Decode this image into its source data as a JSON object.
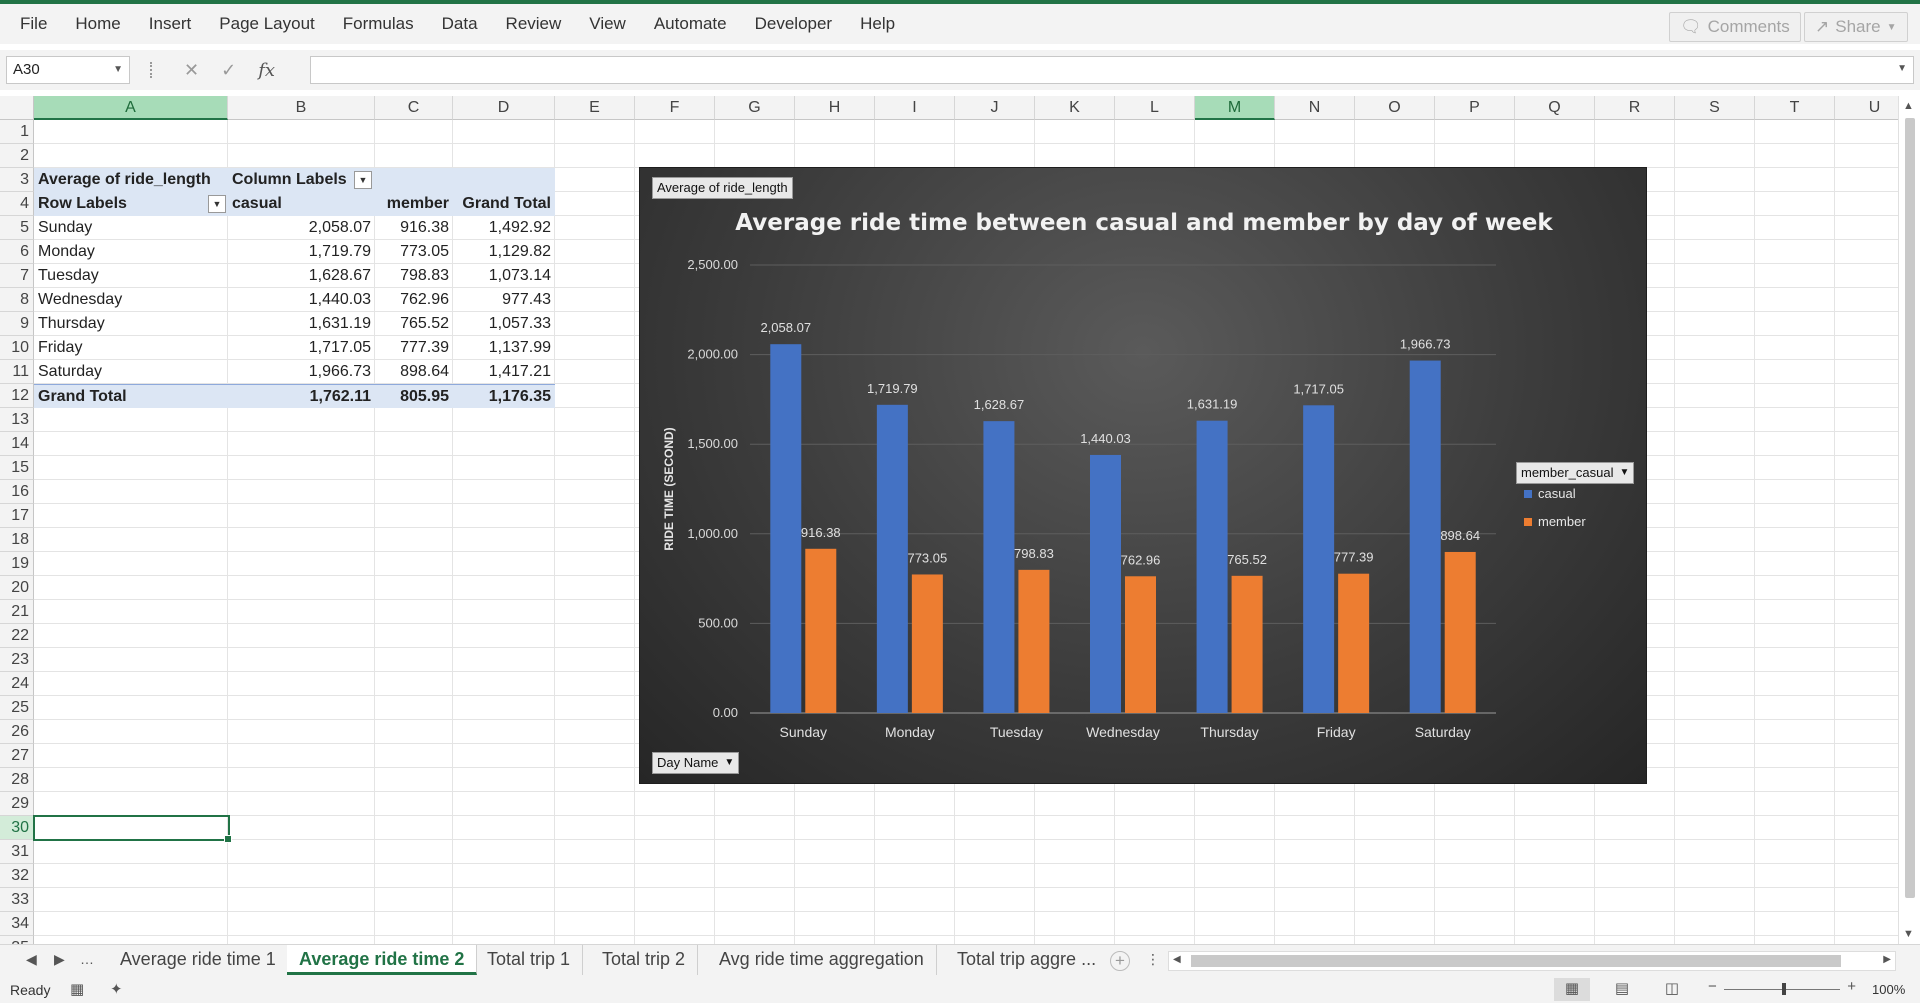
{
  "ribbon": {
    "menu": [
      "File",
      "Home",
      "Insert",
      "Page Layout",
      "Formulas",
      "Data",
      "Review",
      "View",
      "Automate",
      "Developer",
      "Help"
    ],
    "comments_label": "Comments",
    "share_label": "Share"
  },
  "formula_bar": {
    "name_box": "A30",
    "fx_label": "fx",
    "formula": ""
  },
  "columns": [
    "A",
    "B",
    "C",
    "D",
    "E",
    "F",
    "G",
    "H",
    "I",
    "J",
    "K",
    "L",
    "M",
    "N",
    "O",
    "P",
    "Q",
    "R",
    "S",
    "T",
    "U"
  ],
  "rows": [
    "1",
    "2",
    "3",
    "4",
    "5",
    "6",
    "7",
    "8",
    "9",
    "10",
    "11",
    "12",
    "13",
    "14",
    "15",
    "16",
    "17",
    "18",
    "19",
    "20",
    "21",
    "22",
    "23",
    "24",
    "25",
    "26",
    "27",
    "28",
    "29",
    "30",
    "31",
    "32",
    "33",
    "34",
    "35"
  ],
  "pivot": {
    "values_label": "Average of ride_length",
    "column_labels": "Column Labels",
    "row_labels": "Row Labels",
    "headers": [
      "casual",
      "member",
      "Grand Total"
    ],
    "rows": [
      {
        "label": "Sunday",
        "casual": "2,058.07",
        "member": "916.38",
        "total": "1,492.92"
      },
      {
        "label": "Monday",
        "casual": "1,719.79",
        "member": "773.05",
        "total": "1,129.82"
      },
      {
        "label": "Tuesday",
        "casual": "1,628.67",
        "member": "798.83",
        "total": "1,073.14"
      },
      {
        "label": "Wednesday",
        "casual": "1,440.03",
        "member": "762.96",
        "total": "977.43"
      },
      {
        "label": "Thursday",
        "casual": "1,631.19",
        "member": "765.52",
        "total": "1,057.33"
      },
      {
        "label": "Friday",
        "casual": "1,717.05",
        "member": "777.39",
        "total": "1,137.99"
      },
      {
        "label": "Saturday",
        "casual": "1,966.73",
        "member": "898.64",
        "total": "1,417.21"
      }
    ],
    "grand_total": {
      "label": "Grand Total",
      "casual": "1,762.11",
      "member": "805.95",
      "total": "1,176.35"
    }
  },
  "chart_data": {
    "type": "bar",
    "title": "Average ride time between casual and member by day of week",
    "ylabel": "RIDE TIME (SECOND)",
    "xlabel": "",
    "categories": [
      "Sunday",
      "Monday",
      "Tuesday",
      "Wednesday",
      "Thursday",
      "Friday",
      "Saturday"
    ],
    "series": [
      {
        "name": "casual",
        "color": "#4472c4",
        "values": [
          2058.07,
          1719.79,
          1628.67,
          1440.03,
          1631.19,
          1717.05,
          1966.73
        ],
        "labels": [
          "2,058.07",
          "1,719.79",
          "1,628.67",
          "1,440.03",
          "1,631.19",
          "1,717.05",
          "1,966.73"
        ]
      },
      {
        "name": "member",
        "color": "#ed7d31",
        "values": [
          916.38,
          773.05,
          798.83,
          762.96,
          765.52,
          777.39,
          898.64
        ],
        "labels": [
          "916.38",
          "773.05",
          "798.83",
          "762.96",
          "765.52",
          "777.39",
          "898.64"
        ]
      }
    ],
    "ylim": [
      0,
      2500
    ],
    "yticks": [
      "0.00",
      "500.00",
      "1,000.00",
      "1,500.00",
      "2,000.00",
      "2,500.00"
    ],
    "grid": true,
    "legend_position": "right",
    "field_buttons": {
      "values": "Average of ride_length",
      "legend": "member_casual",
      "axis": "Day Name"
    }
  },
  "sheet_tabs": [
    "Average ride time 1",
    "Average ride time 2",
    "Total trip 1",
    "Total trip 2",
    "Avg ride time aggregation",
    "Total trip aggre ..."
  ],
  "active_tab": "Average ride time 2",
  "status": {
    "ready": "Ready",
    "zoom": "100%"
  }
}
